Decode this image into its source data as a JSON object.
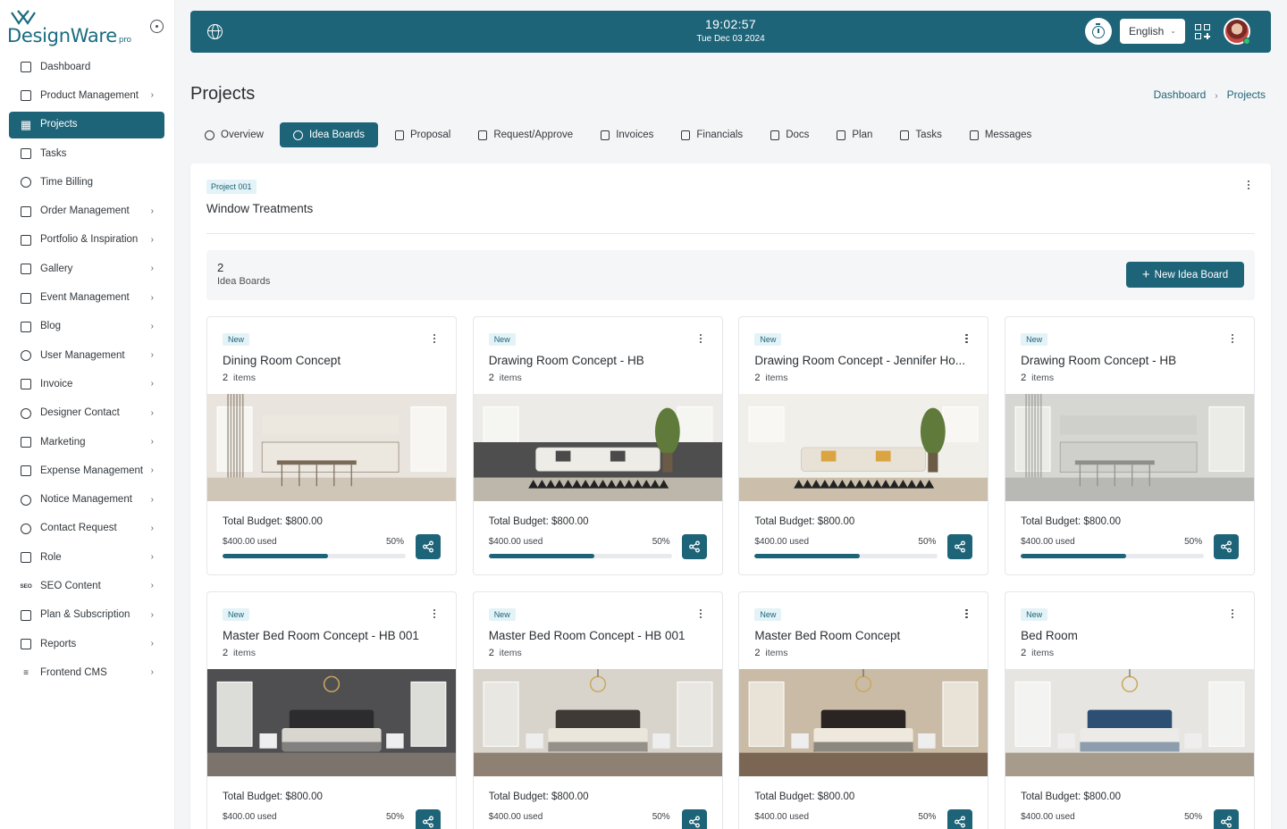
{
  "app": {
    "logo_text": "DesignWare",
    "logo_suffix": "pro"
  },
  "sidebar": {
    "items": [
      {
        "label": "Dashboard",
        "icon": "home-icon",
        "chevron": false
      },
      {
        "label": "Product Management",
        "icon": "box-icon",
        "chevron": true
      },
      {
        "label": "Projects",
        "icon": "grid-icon",
        "chevron": false,
        "active": true
      },
      {
        "label": "Tasks",
        "icon": "clipboard-icon",
        "chevron": false
      },
      {
        "label": "Time Billing",
        "icon": "clock-icon",
        "chevron": false
      },
      {
        "label": "Order Management",
        "icon": "truck-icon",
        "chevron": true
      },
      {
        "label": "Portfolio & Inspiration",
        "icon": "map-icon",
        "chevron": true
      },
      {
        "label": "Gallery",
        "icon": "image-icon",
        "chevron": true
      },
      {
        "label": "Event Management",
        "icon": "calendar-icon",
        "chevron": true
      },
      {
        "label": "Blog",
        "icon": "blog-icon",
        "chevron": true
      },
      {
        "label": "User Management",
        "icon": "users-icon",
        "chevron": true
      },
      {
        "label": "Invoice",
        "icon": "file-icon",
        "chevron": true
      },
      {
        "label": "Designer Contact",
        "icon": "user-icon",
        "chevron": true
      },
      {
        "label": "Marketing",
        "icon": "megaphone-icon",
        "chevron": true
      },
      {
        "label": "Expense Management",
        "icon": "receipt-icon",
        "chevron": true
      },
      {
        "label": "Notice Management",
        "icon": "bell-icon",
        "chevron": true
      },
      {
        "label": "Contact Request",
        "icon": "contact-icon",
        "chevron": true
      },
      {
        "label": "Role",
        "icon": "lock-icon",
        "chevron": true
      },
      {
        "label": "SEO Content",
        "icon": "seo-icon",
        "chevron": true
      },
      {
        "label": "Plan & Subscription",
        "icon": "plan-icon",
        "chevron": true
      },
      {
        "label": "Reports",
        "icon": "report-icon",
        "chevron": true
      },
      {
        "label": "Frontend CMS",
        "icon": "sliders-icon",
        "chevron": true
      }
    ]
  },
  "header": {
    "time": "19:02:57",
    "date": "Tue Dec 03 2024",
    "language": "English",
    "accent_color": "#1e6478"
  },
  "page": {
    "title": "Projects",
    "breadcrumb": [
      "Dashboard",
      "Projects"
    ]
  },
  "tabs": [
    {
      "label": "Overview",
      "icon": "palette-icon"
    },
    {
      "label": "Idea Boards",
      "icon": "bulb-icon",
      "active": true
    },
    {
      "label": "Proposal",
      "icon": "document-icon"
    },
    {
      "label": "Request/Approve",
      "icon": "clipboard-check-icon"
    },
    {
      "label": "Invoices",
      "icon": "file-icon"
    },
    {
      "label": "Financials",
      "icon": "clipboard-icon"
    },
    {
      "label": "Docs",
      "icon": "pdf-icon"
    },
    {
      "label": "Plan",
      "icon": "plan-icon"
    },
    {
      "label": "Tasks",
      "icon": "layers-icon"
    },
    {
      "label": "Messages",
      "icon": "message-icon"
    }
  ],
  "project": {
    "badge": "Project 001",
    "title": "Window Treatments"
  },
  "summary": {
    "count": "2",
    "label": "Idea Boards",
    "new_button": "New Idea Board"
  },
  "boards": [
    {
      "badge": "New",
      "title": "Dining Room Concept",
      "items_count": "2",
      "items_label": "items",
      "budget": "Total Budget: $800.00",
      "used": "$400.00 used",
      "percent": "50%",
      "progress": 0.5,
      "scene": "dining"
    },
    {
      "badge": "New",
      "title": "Drawing Room Concept - HB",
      "items_count": "2",
      "items_label": "items",
      "budget": "Total Budget: $800.00",
      "used": "$400.00 used",
      "percent": "50%",
      "progress": 0.5,
      "scene": "living-dark"
    },
    {
      "badge": "New",
      "title": "Drawing Room Concept - Jennifer Ho...",
      "items_count": "2",
      "items_label": "items",
      "budget": "Total Budget: $800.00",
      "used": "$400.00 used",
      "percent": "50%",
      "progress": 0.5,
      "scene": "living-light"
    },
    {
      "badge": "New",
      "title": "Drawing Room Concept - HB",
      "items_count": "2",
      "items_label": "items",
      "budget": "Total Budget: $800.00",
      "used": "$400.00 used",
      "percent": "50%",
      "progress": 0.5,
      "scene": "kitchen-gray"
    },
    {
      "badge": "New",
      "title": "Master Bed Room Concept - HB 001",
      "items_count": "2",
      "items_label": "items",
      "budget": "Total Budget: $800.00",
      "used": "$400.00 used",
      "percent": "50%",
      "progress": 0.5,
      "scene": "bed-dark"
    },
    {
      "badge": "New",
      "title": "Master Bed Room Concept - HB 001",
      "items_count": "2",
      "items_label": "items",
      "budget": "Total Budget: $800.00",
      "used": "$400.00 used",
      "percent": "50%",
      "progress": 0.5,
      "scene": "bed-classic"
    },
    {
      "badge": "New",
      "title": "Master Bed Room Concept",
      "items_count": "2",
      "items_label": "items",
      "budget": "Total Budget: $800.00",
      "used": "$400.00 used",
      "percent": "50%",
      "progress": 0.5,
      "scene": "bed-warm"
    },
    {
      "badge": "New",
      "title": "Bed Room",
      "items_count": "2",
      "items_label": "items",
      "budget": "Total Budget: $800.00",
      "used": "$400.00 used",
      "percent": "50%",
      "progress": 0.5,
      "scene": "bed-blue"
    }
  ]
}
